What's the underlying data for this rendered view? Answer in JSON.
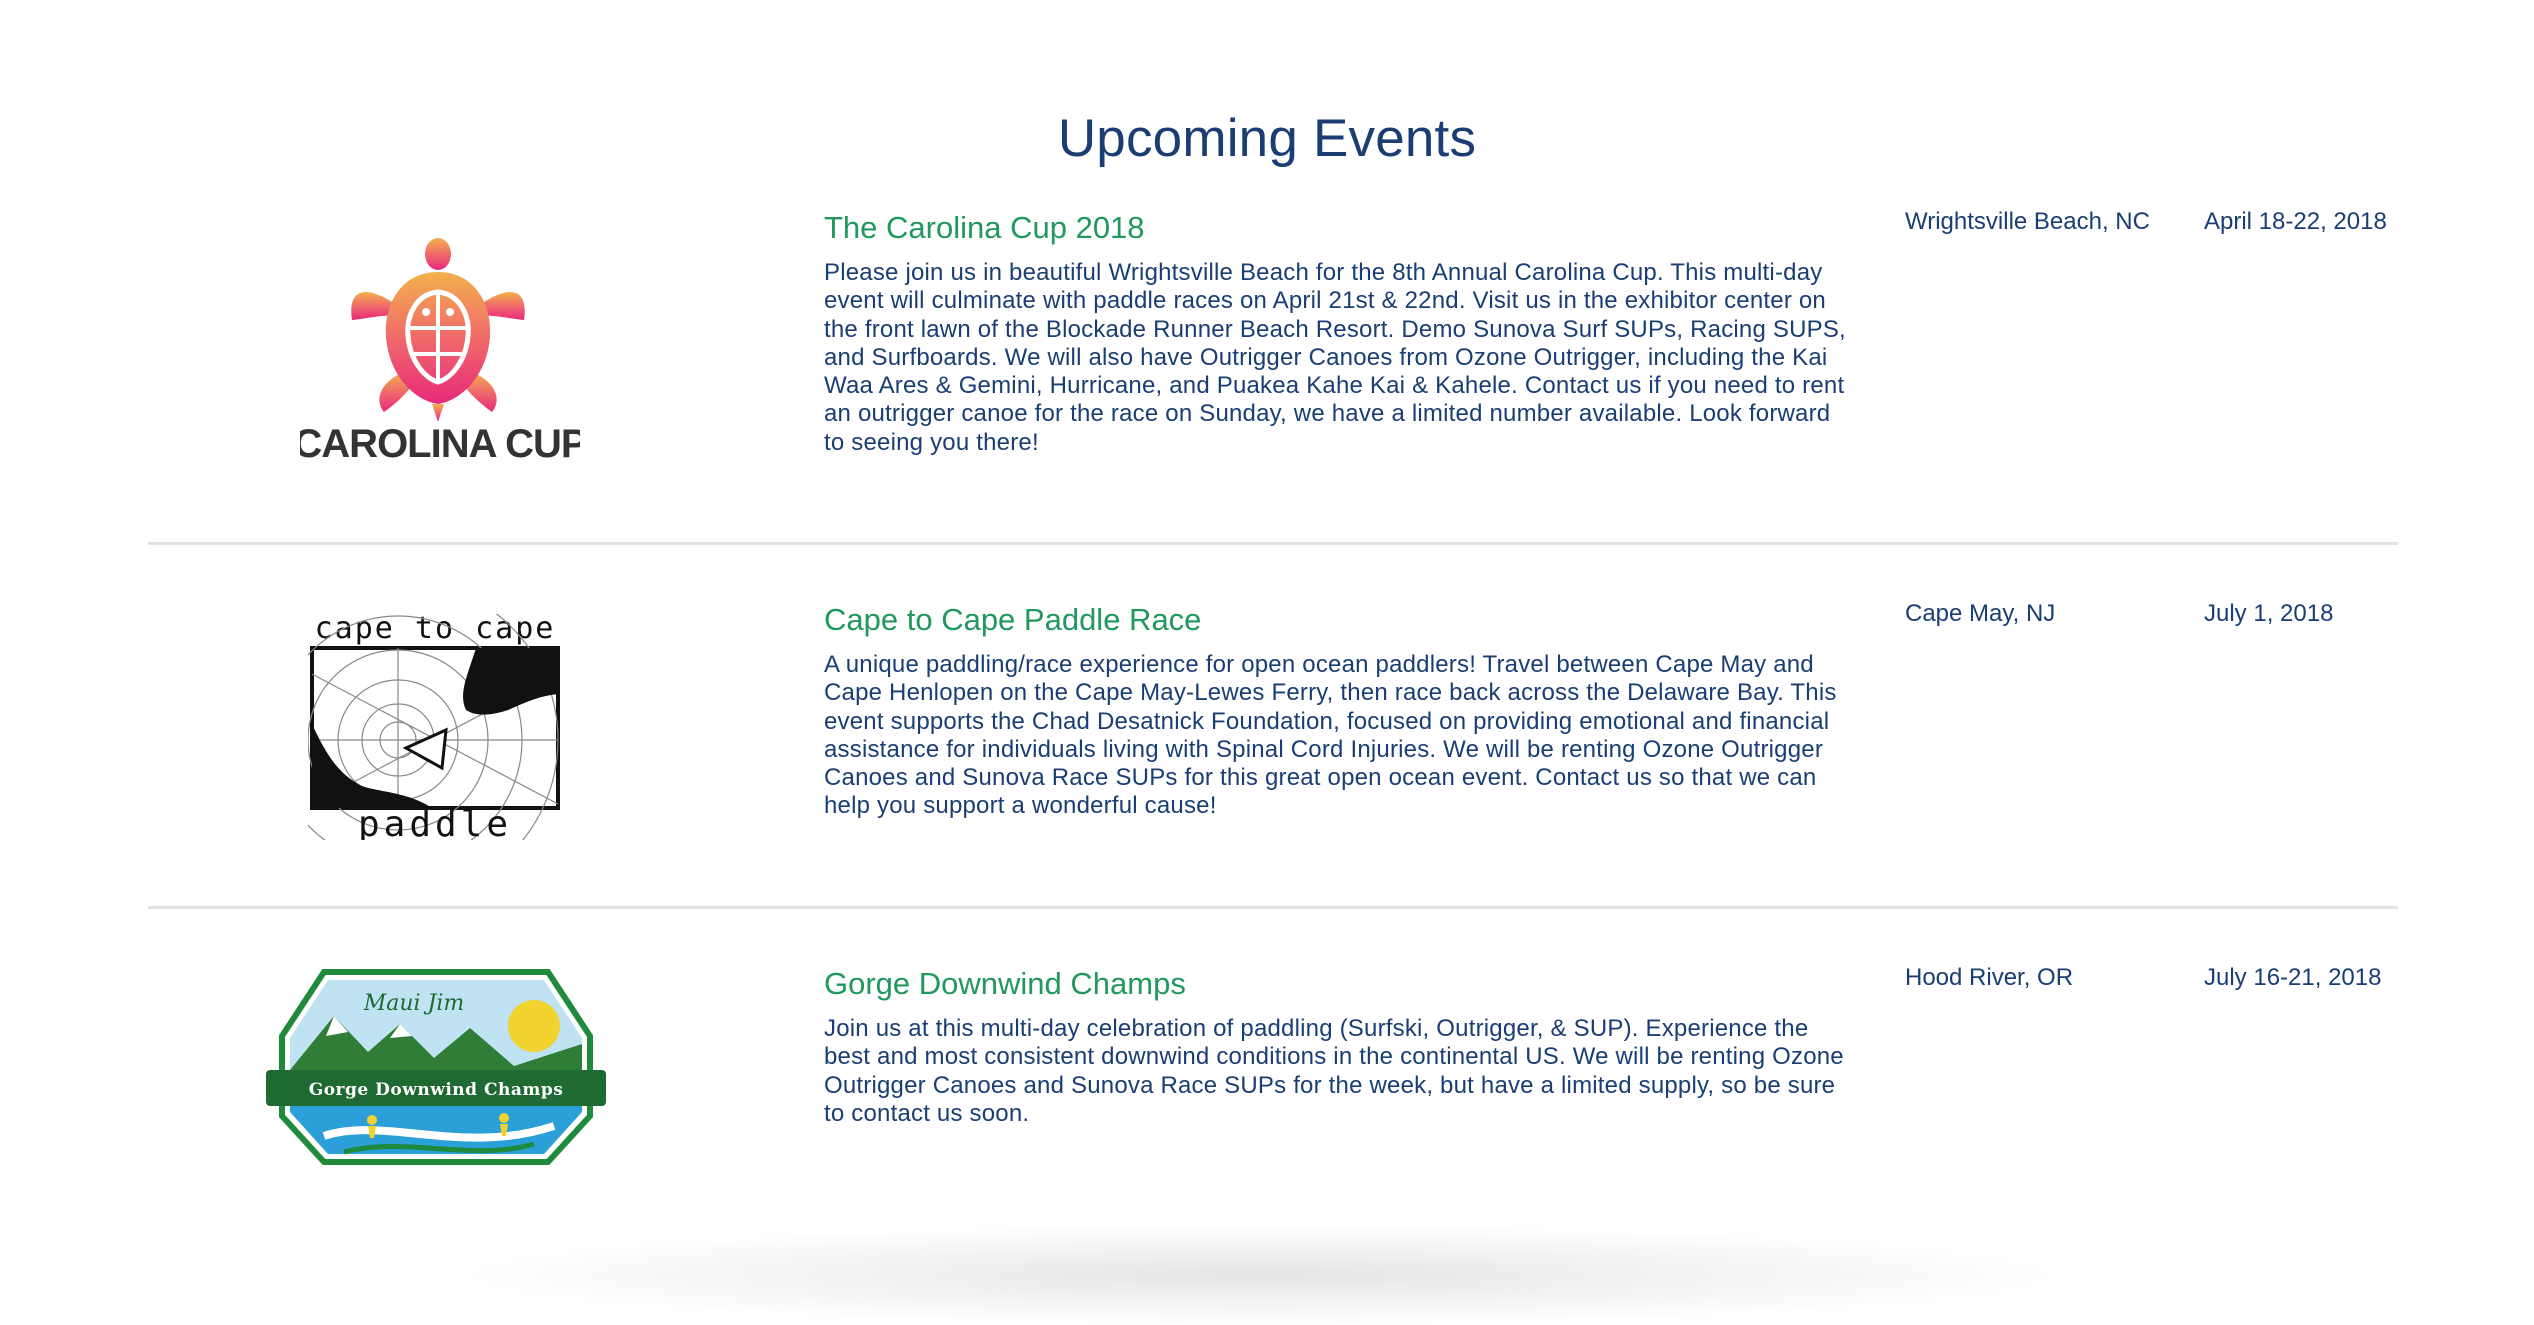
{
  "page": {
    "title": "Upcoming Events"
  },
  "colors": {
    "heading": "#1a3e73",
    "event_title": "#21985d",
    "divider": "#e3e3e3"
  },
  "events": [
    {
      "logo_text": "CAROLINA CUP",
      "logo_icon": "sea-turtle-icon",
      "title": "The Carolina Cup 2018",
      "description": "Please join us in beautiful Wrightsville Beach for the 8th Annual Carolina Cup. This multi-day event will culminate with paddle races on April 21st & 22nd. Visit us in the exhibitor center on the front lawn of the Blockade Runner Beach Resort. Demo Sunova Surf SUPs, Racing SUPS, and Surfboards. We will also have Outrigger Canoes from Ozone Outrigger, including the Kai Waa Ares & Gemini, Hurricane, and Puakea Kahe Kai & Kahele. Contact us if you need to rent an outrigger canoe for the race on Sunday, we have a limited number available. Look forward to seeing you there!",
      "location": "Wrightsville Beach, NC",
      "date": "April 18-22, 2018"
    },
    {
      "logo_text_top": "cape to cape",
      "logo_text_bottom": "paddle",
      "logo_icon": "cape-map-icon",
      "title": "Cape to Cape Paddle Race",
      "description": "A unique paddling/race experience for open ocean paddlers! Travel between Cape May and Cape Henlopen on the Cape May-Lewes Ferry, then race back across the Delaware Bay. This event supports the Chad Desatnick Foundation, focused on providing emotional and financial assistance for individuals living with Spinal Cord Injuries. We will be renting Ozone Outrigger Canoes and Sunova Race SUPs for this great open ocean event. Contact us so that we can help you support a wonderful cause!",
      "location": "Cape May, NJ",
      "date": "July 1, 2018"
    },
    {
      "logo_text_top": "Maui Jim",
      "logo_text_banner": "Gorge Downwind Champs",
      "logo_icon": "mountains-river-icon",
      "title": "Gorge Downwind Champs",
      "description": "Join us at this multi-day celebration of paddling (Surfski, Outrigger, & SUP). Experience the best and most consistent downwind conditions in the continental US. We will be renting Ozone Outrigger Canoes and Sunova Race SUPs for the week, but have a limited supply, so be sure to contact us soon.",
      "location": "Hood River, OR",
      "date": "July 16-21, 2018"
    }
  ]
}
